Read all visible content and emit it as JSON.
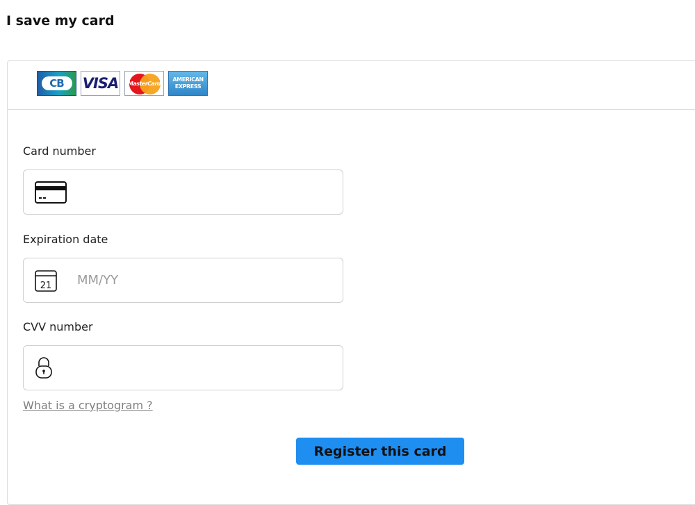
{
  "page": {
    "title": "I save my card"
  },
  "logos": [
    {
      "name": "cb-logo",
      "text": "CB"
    },
    {
      "name": "visa-logo",
      "text": "VISA"
    },
    {
      "name": "mastercard-logo",
      "text": "MasterCard"
    },
    {
      "name": "amex-logo",
      "line1": "AMERICAN",
      "line2": "EXPRESS"
    }
  ],
  "form": {
    "card_number": {
      "label": "Card number",
      "value": "",
      "placeholder": "",
      "icon": "credit-card-icon"
    },
    "expiration": {
      "label": "Expiration date",
      "value": "",
      "placeholder": "MM/YY",
      "icon": "calendar-icon",
      "icon_text": "21"
    },
    "cvv": {
      "label": "CVV number",
      "value": "",
      "placeholder": "",
      "icon": "lock-icon"
    },
    "help_link": "What is a cryptogram ?",
    "submit_label": "Register this card"
  },
  "colors": {
    "button": "#1f8ef1",
    "link": "#808080",
    "border": "#dcdcdc"
  }
}
